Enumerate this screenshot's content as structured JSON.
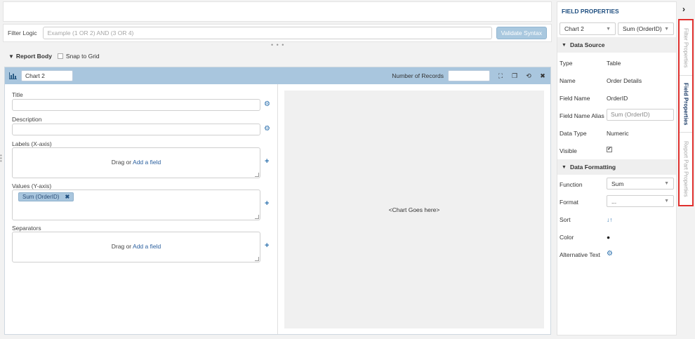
{
  "filter": {
    "label": "Filter Logic",
    "placeholder": "Example (1 OR 2) AND (3 OR 4)",
    "validate_label": "Validate Syntax"
  },
  "report_body": {
    "label": "Report Body",
    "snap_label": "Snap to Grid"
  },
  "chart": {
    "name": "Chart 2",
    "num_records_label": "Number of Records",
    "title_label": "Title",
    "description_label": "Description",
    "labels_label": "Labels (X-axis)",
    "values_label": "Values (Y-axis)",
    "separators_label": "Separators",
    "drag_text": "Drag or",
    "add_field_text": "Add a field",
    "value_pill": "Sum (OrderID)",
    "placeholder_text": "<Chart Goes here>"
  },
  "props": {
    "title": "FIELD PROPERTIES",
    "chart_select": "Chart 2",
    "field_select": "Sum (OrderID)",
    "data_source_label": "Data Source",
    "type_key": "Type",
    "type_val": "Table",
    "name_key": "Name",
    "name_val": "Order Details",
    "field_name_key": "Field Name",
    "field_name_val": "OrderID",
    "alias_key": "Field Name Alias",
    "alias_val": "Sum (OrderID)",
    "data_type_key": "Data Type",
    "data_type_val": "Numeric",
    "visible_key": "Visible",
    "visible_check": "✔",
    "data_formatting_label": "Data Formatting",
    "function_key": "Function",
    "function_val": "Sum",
    "format_key": "Format",
    "format_val": "...",
    "sort_key": "Sort",
    "sort_icon": "↓↑",
    "color_key": "Color",
    "color_icon": "●",
    "alt_text_key": "Alternative Text"
  },
  "tabs": {
    "filter": "Filter Properties",
    "field": "Field Properties",
    "report_part": "Report Part Properties"
  },
  "colors": {
    "accent": "#a9c6de",
    "highlight": "#e0302e",
    "link": "#2a5f9e"
  }
}
